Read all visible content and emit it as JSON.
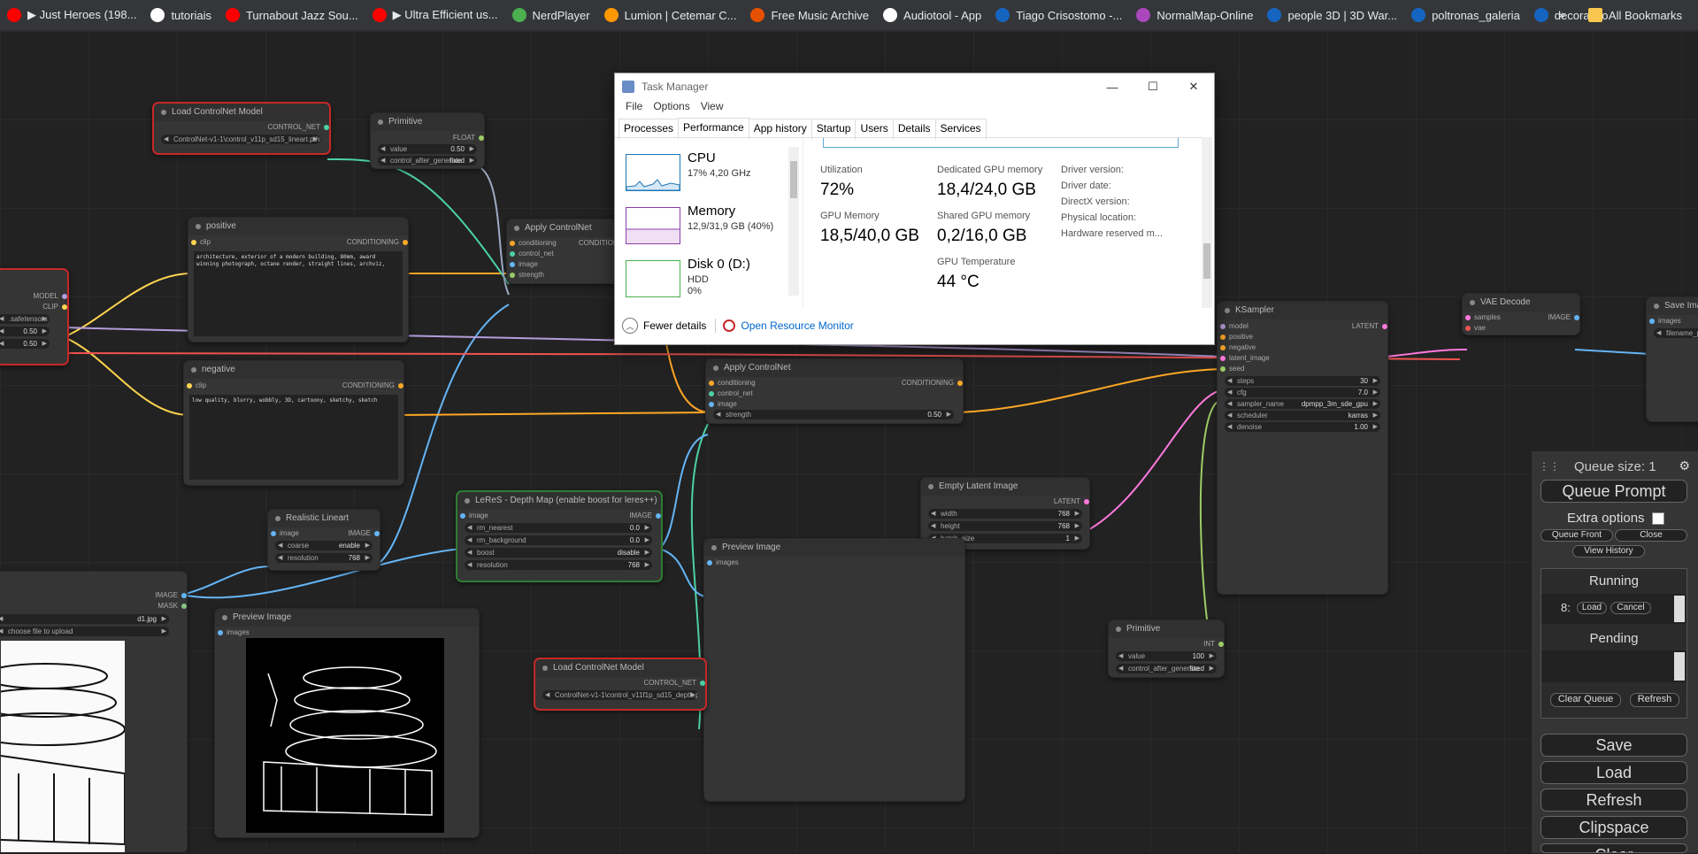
{
  "bookmarks": [
    {
      "label": "▶ Just Heroes (198...",
      "color": "#ff0000"
    },
    {
      "label": "tutoriais",
      "color": "#ffffff"
    },
    {
      "label": "Turnabout Jazz Sou...",
      "color": "#ff0000"
    },
    {
      "label": "▶ Ultra Efficient us...",
      "color": "#ff0000"
    },
    {
      "label": "NerdPlayer",
      "color": "#4caf50"
    },
    {
      "label": "Lumion | Cetemar C...",
      "color": "#ff9800"
    },
    {
      "label": "Free Music Archive",
      "color": "#e65100"
    },
    {
      "label": "Audiotool - App",
      "color": "#ffffff"
    },
    {
      "label": "Tiago Crisostomo -...",
      "color": "#1565c0"
    },
    {
      "label": "NormalMap-Online",
      "color": "#ab47bc"
    },
    {
      "label": "people 3D | 3D War...",
      "color": "#1565c0"
    },
    {
      "label": "poltronas_galeria",
      "color": "#1565c0"
    },
    {
      "label": "decoração",
      "color": "#1565c0"
    }
  ],
  "bookmarks_more": "»",
  "bookmarks_all": "All Bookmarks",
  "nodes": {
    "load_cn1": {
      "title": "Load ControlNet Model",
      "out": "CONTROL_NET",
      "widget": "ControlNet-v1-1\\control_v11p_sd15_lineart.pth"
    },
    "primitive1": {
      "title": "Primitive",
      "out": "FLOAT",
      "w1": "value",
      "v1": "0.50",
      "w2": "control_after_generate",
      "v2": "fixed"
    },
    "positive": {
      "title": "positive",
      "in": "clip",
      "out": "CONDITIONING",
      "text": "architecture, exterior of a modern building, 80mm, award winning photograph, octane render, straight lines, archviz,"
    },
    "apply_cn1": {
      "title": "Apply ControlNet",
      "ins": [
        "conditioning",
        "control_net",
        "image",
        "strength"
      ],
      "out": "CONDITIONING"
    },
    "checkpoint": {
      "outs": [
        "MODEL",
        "CLIP"
      ],
      "widget": ".safetensors",
      "v1": "0.50",
      "v2": "0.50"
    },
    "negative": {
      "title": "negative",
      "in": "clip",
      "out": "CONDITIONING",
      "text": "low quality, blurry, wobbly, 3D, cartoony, sketchy, sketch"
    },
    "apply_cn2": {
      "title": "Apply ControlNet",
      "ins": [
        "conditioning",
        "control_net",
        "image"
      ],
      "out": "CONDITIONING",
      "w": "strength",
      "v": "0.50"
    },
    "ksampler": {
      "title": "KSampler",
      "ins": [
        "model",
        "positive",
        "negative",
        "latent_image",
        "seed"
      ],
      "out": "LATENT",
      "widgets": [
        [
          "steps",
          "30"
        ],
        [
          "cfg",
          "7.0"
        ],
        [
          "sampler_name",
          "dpmpp_3m_sde_gpu"
        ],
        [
          "scheduler",
          "karras"
        ],
        [
          "denoise",
          "1.00"
        ]
      ]
    },
    "vae_decode": {
      "title": "VAE Decode",
      "ins": [
        "samples",
        "vae"
      ],
      "out": "IMAGE"
    },
    "save_image": {
      "title": "Save Image",
      "in": "images",
      "widget": "filename_pre"
    },
    "realistic_lineart": {
      "title": "Realistic Lineart",
      "in": "image",
      "out": "IMAGE",
      "widgets": [
        [
          "coarse",
          "enable"
        ],
        [
          "resolution",
          "768"
        ]
      ]
    },
    "leres": {
      "title": "LeReS - Depth Map (enable boost for leres++)",
      "in": "image",
      "out": "IMAGE",
      "widgets": [
        [
          "rm_nearest",
          "0.0"
        ],
        [
          "rm_background",
          "0.0"
        ],
        [
          "boost",
          "disable"
        ],
        [
          "resolution",
          "768"
        ]
      ]
    },
    "empty_latent": {
      "title": "Empty Latent Image",
      "out": "LATENT",
      "widgets": [
        [
          "width",
          "768"
        ],
        [
          "height",
          "768"
        ],
        [
          "batch_size",
          "1"
        ]
      ]
    },
    "preview1": {
      "title": "Preview Image",
      "in": "images"
    },
    "preview2": {
      "title": "Preview Image",
      "in": "images"
    },
    "load_image": {
      "outs": [
        "IMAGE",
        "MASK"
      ],
      "widget": "d1.jpg",
      "upload": "choose file to upload"
    },
    "load_cn2": {
      "title": "Load ControlNet Model",
      "out": "CONTROL_NET",
      "widget": "ControlNet-v1-1\\control_v11f1p_sd15_depth.pth"
    },
    "primitive2": {
      "title": "Primitive",
      "out": "INT",
      "w1": "value",
      "v1": "100",
      "w2": "control_after_generate",
      "v2": "fixed"
    }
  },
  "task_manager": {
    "title": "Task Manager",
    "menu": [
      "File",
      "Options",
      "View"
    ],
    "tabs": [
      "Processes",
      "Performance",
      "App history",
      "Startup",
      "Users",
      "Details",
      "Services"
    ],
    "resources": [
      {
        "name": "CPU",
        "sub": "17%  4,20 GHz",
        "color": "#1f77b4"
      },
      {
        "name": "Memory",
        "sub": "12,9/31,9 GB (40%)",
        "color": "#8b3fa8"
      },
      {
        "name": "Disk 0 (D:)",
        "sub": "HDD\n0%",
        "color": "#4caf50"
      }
    ],
    "stats": {
      "util_label": "Utilization",
      "util": "72%",
      "ded_label": "Dedicated GPU memory",
      "ded": "18,4/24,0 GB",
      "gpu_mem_label": "GPU Memory",
      "gpu_mem": "18,5/40,0 GB",
      "shared_label": "Shared GPU memory",
      "shared": "0,2/16,0 GB",
      "temp_label": "GPU Temperature",
      "temp": "44 °C",
      "driver_version": "Driver version:",
      "driver_date": "Driver date:",
      "directx": "DirectX version:",
      "phys_loc": "Physical location:",
      "hw_reserved": "Hardware reserved m..."
    },
    "fewer": "Fewer details",
    "open_rm": "Open Resource Monitor"
  },
  "queue": {
    "size": "Queue size: 1",
    "queue_prompt": "Queue Prompt",
    "extra": "Extra options",
    "queue_front": "Queue Front",
    "close": "Close",
    "view_history": "View History",
    "running": "Running",
    "run_item": "8:",
    "load": "Load",
    "cancel": "Cancel",
    "pending": "Pending",
    "clear_queue": "Clear Queue",
    "refresh_small": "Refresh",
    "save": "Save",
    "load_btn": "Load",
    "refresh": "Refresh",
    "clipspace": "Clipspace",
    "clear": "Clear"
  }
}
